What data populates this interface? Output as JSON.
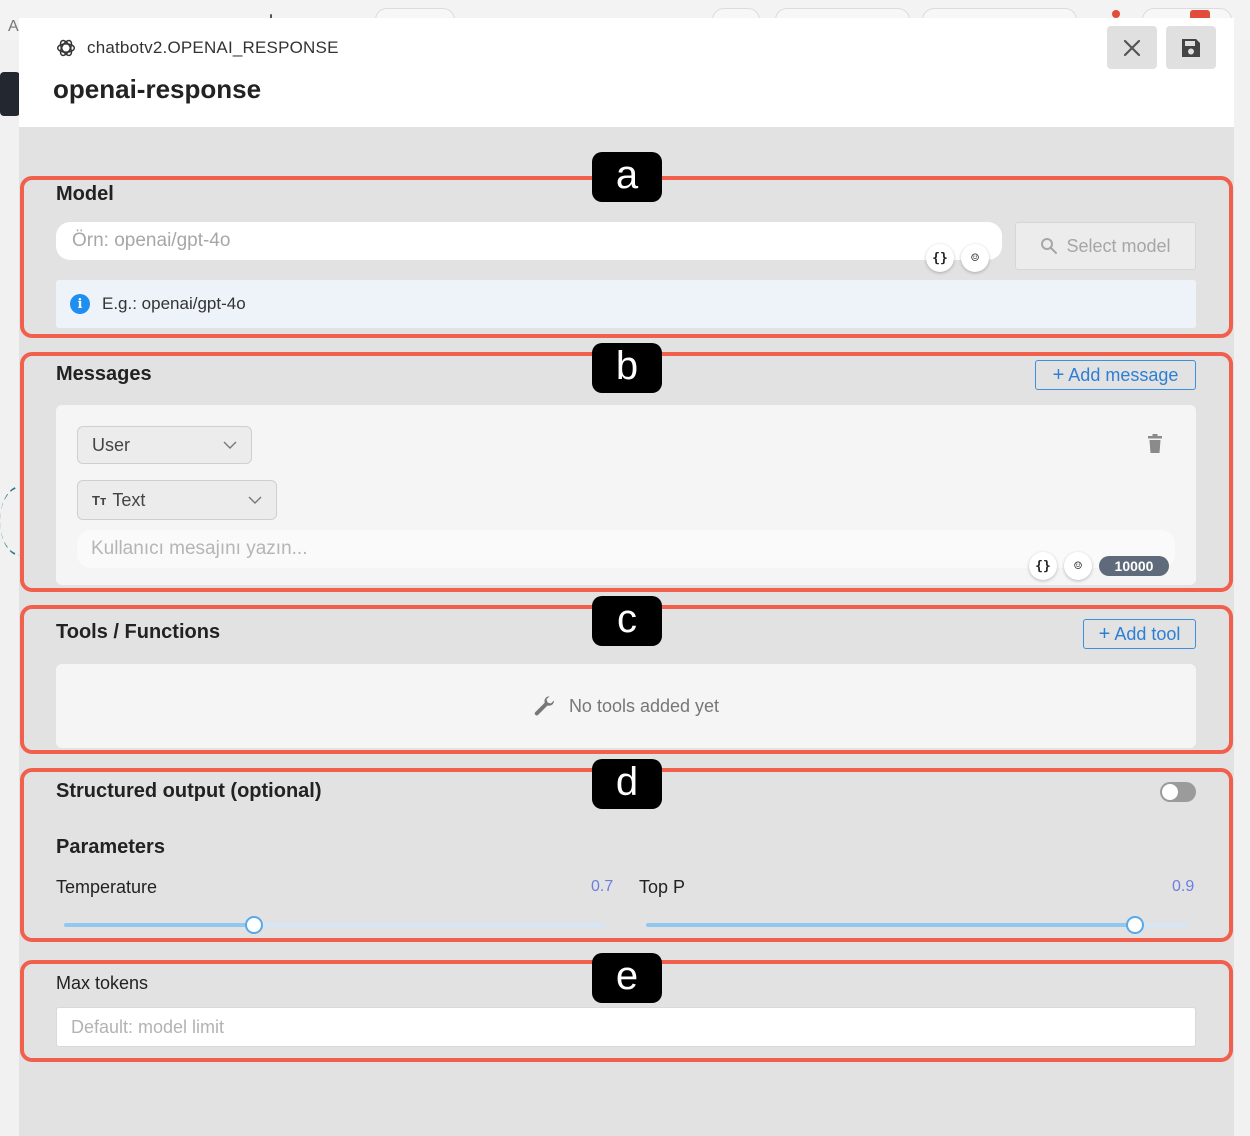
{
  "header": {
    "node_type": "chatbotv2.OPENAI_RESPONSE",
    "title": "openai-response",
    "close_icon": "close-icon",
    "save_icon": "save-icon"
  },
  "annotations": [
    "a",
    "b",
    "c",
    "d",
    "e"
  ],
  "model": {
    "label": "Model",
    "placeholder": "Örn: openai/gpt-4o",
    "select_button": "Select model",
    "info_text": "E.g.: openai/gpt-4o"
  },
  "messages": {
    "label": "Messages",
    "add_button": "Add message",
    "role": "User",
    "content_type": "Text",
    "input_placeholder": "Kullanıcı mesajını yazın...",
    "char_limit": "10000"
  },
  "tools": {
    "label": "Tools / Functions",
    "add_button": "Add tool",
    "empty_text": "No tools added yet"
  },
  "structured_output": {
    "label": "Structured output (optional)",
    "enabled": false
  },
  "parameters": {
    "label": "Parameters",
    "temperature": {
      "label": "Temperature",
      "value": "0.7",
      "fraction": 0.35
    },
    "top_p": {
      "label": "Top P",
      "value": "0.9",
      "fraction": 0.9
    }
  },
  "max_tokens": {
    "label": "Max tokens",
    "placeholder": "Default: model limit"
  },
  "colors": {
    "annotation_border": "#f0604d",
    "accent_blue": "#2d7fd6",
    "slider": "#58a9ea"
  }
}
